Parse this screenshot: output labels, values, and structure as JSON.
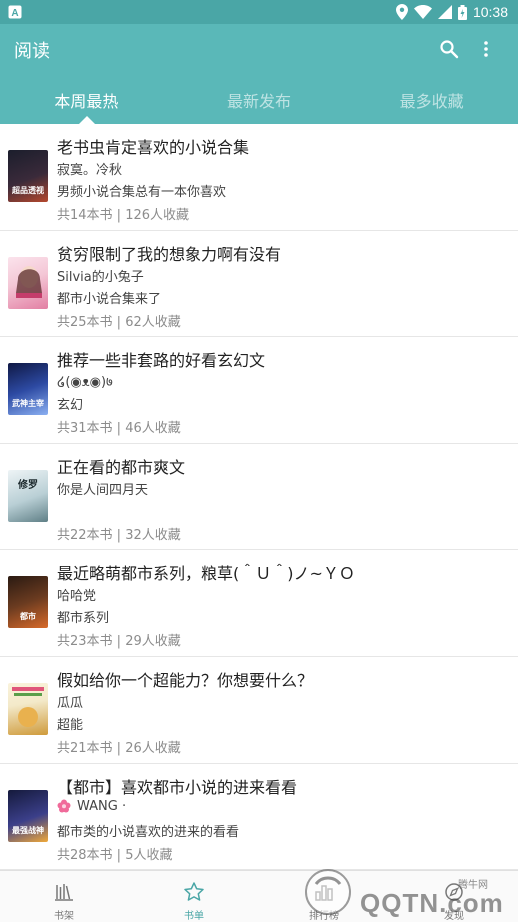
{
  "status_bar": {
    "time": "10:38"
  },
  "app_bar": {
    "title": "阅读"
  },
  "tabs": [
    {
      "label": "本周最热",
      "active": true
    },
    {
      "label": "最新发布",
      "active": false
    },
    {
      "label": "最多收藏",
      "active": false
    }
  ],
  "lists": [
    {
      "title": "老书虫肯定喜欢的小说合集",
      "author": "寂寞。冷秋",
      "desc": "男频小说合集总有一本你喜欢",
      "books": "共14本书",
      "favorites": "126人收藏",
      "cover_text": "超品透视",
      "cover_colors": [
        "#1b1e2c",
        "#b5482e"
      ]
    },
    {
      "title": "贫穷限制了我的想象力啊有没有",
      "author": "Silvia的小兔子",
      "desc": "都市小说合集来了",
      "books": "共25本书",
      "favorites": "62人收藏",
      "cover_text": "",
      "cover_colors": [
        "#f4c7d6",
        "#e27fa3"
      ]
    },
    {
      "title": "推荐一些非套路的好看玄幻文",
      "author": "໒(◉ᴥ◉)७",
      "desc": "玄幻",
      "books": "共31本书",
      "favorites": "46人收藏",
      "cover_text": "武神主宰",
      "cover_colors": [
        "#1d2b66",
        "#6a8ee0"
      ]
    },
    {
      "title": "正在看的都市爽文",
      "author": "你是人间四月天",
      "desc": "",
      "books": "共22本书",
      "favorites": "32人收藏",
      "cover_text": "修罗",
      "cover_colors": [
        "#d9e6ea",
        "#5f7f86"
      ]
    },
    {
      "title": "最近略萌都市系列，粮草(＾Ｕ＾)ノ~ＹＯ",
      "author": "哈哈党",
      "desc": "都市系列",
      "books": "共23本书",
      "favorites": "29人收藏",
      "cover_text": "都市",
      "cover_colors": [
        "#3b2418",
        "#d86a2a"
      ]
    },
    {
      "title": "假如给你一个超能力？你想要什么？",
      "author": "瓜瓜",
      "desc": "超能",
      "books": "共21本书",
      "favorites": "26人收藏",
      "cover_text": "",
      "cover_colors": [
        "#f3e9c9",
        "#cf9b3c"
      ]
    },
    {
      "title": "【都市】喜欢都市小说的进来看看",
      "author": "WANG ·",
      "author_icon": "flower-icon",
      "desc": "都市类的小说喜欢的进来的看看",
      "books": "共28本书",
      "favorites": "5人收藏",
      "cover_text": "最强战神",
      "cover_colors": [
        "#1a1f45",
        "#f0a93a"
      ]
    }
  ],
  "bottom_nav": [
    {
      "label": "书架",
      "icon": "bookshelf-icon",
      "active": false
    },
    {
      "label": "书单",
      "icon": "star-icon",
      "active": true
    },
    {
      "label": "排行榜",
      "icon": "ranking-icon",
      "active": false
    },
    {
      "label": "发现",
      "icon": "discover-icon",
      "active": false
    }
  ],
  "watermark": {
    "text": "QQTN.com",
    "small": "腾牛网"
  },
  "colors": {
    "primary": "#5ab8b8",
    "status": "#4aa6a6",
    "accent": "#4aa6a6"
  }
}
